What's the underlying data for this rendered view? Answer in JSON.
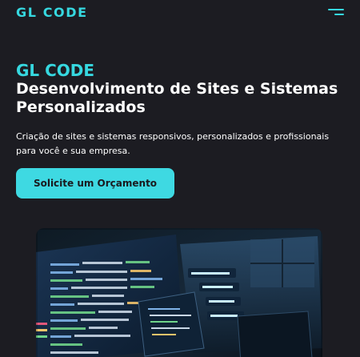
{
  "header": {
    "logo": "GL CODE",
    "menu_icon": "hamburger-menu-icon"
  },
  "hero": {
    "brand": "GL CODE",
    "title": "Desenvolvimento de Sites e Sistemas Personalizados",
    "description": "Criação de sites e sistemas responsivos, personalizados e profissionais para você e sua empresa.",
    "cta_label": "Solicite um Orçamento",
    "image": "code-screens-illustration"
  },
  "colors": {
    "background": "#1c1c22",
    "accent": "#36d8e0",
    "button": "#3ed9e2",
    "text": "#ffffff"
  }
}
